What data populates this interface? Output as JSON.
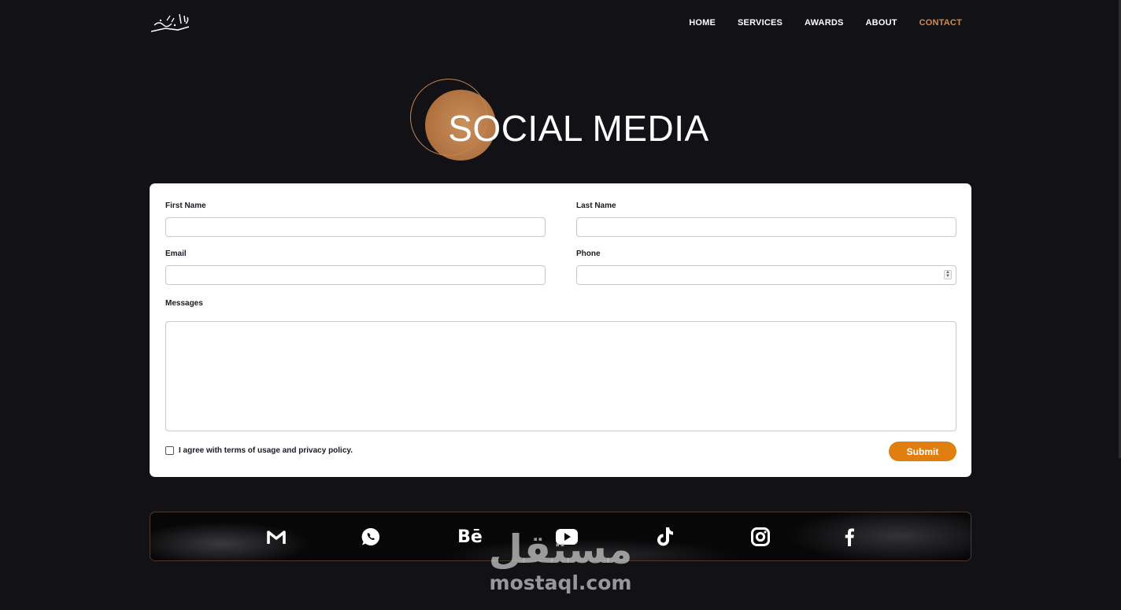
{
  "nav": {
    "items": [
      {
        "label": "HOME",
        "active": false
      },
      {
        "label": "SERVICES",
        "active": false
      },
      {
        "label": "AWARDS",
        "active": false
      },
      {
        "label": "ABOUT",
        "active": false
      },
      {
        "label": "CONTACT",
        "active": true
      }
    ]
  },
  "hero": {
    "title": "SOCIAL MEDIA"
  },
  "form": {
    "first_name_label": "First Name",
    "first_name_value": "",
    "last_name_label": "Last Name",
    "last_name_value": "",
    "email_label": "Email",
    "email_value": "",
    "phone_label": "Phone",
    "phone_value": "",
    "messages_label": "Messages",
    "messages_value": "",
    "agree_label": "I agree with terms of usage and privacy policy.",
    "agree_checked": false,
    "submit_label": "Submit"
  },
  "social": {
    "icons": [
      "gmail-icon",
      "whatsapp-icon",
      "behance-icon",
      "youtube-icon",
      "tiktok-icon",
      "instagram-icon",
      "facebook-icon"
    ],
    "behance_glyph": "Bē"
  },
  "watermark": {
    "arabic": "مستقل",
    "latin": "mostaql.com"
  },
  "colors": {
    "accent": "#e07f0f",
    "nav_active": "#d68a45",
    "background": "#111116",
    "card": "#ffffff"
  }
}
